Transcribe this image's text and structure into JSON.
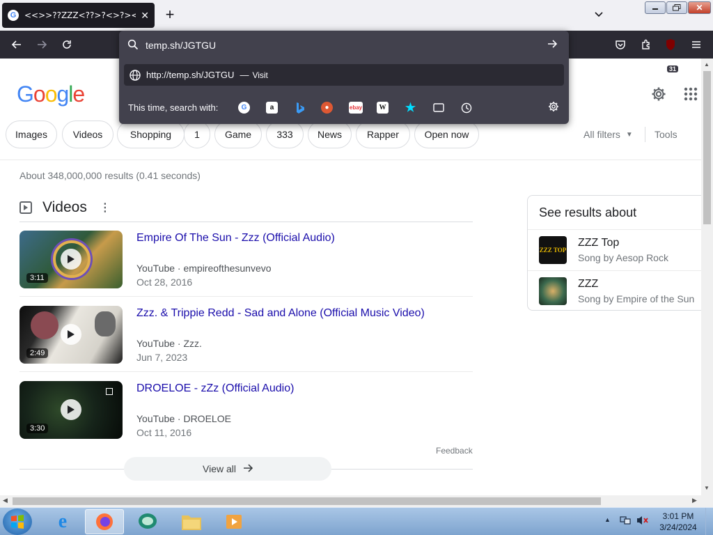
{
  "browser": {
    "tab_title": "<<>>??ZZZ<??>?<>?><?><",
    "tab_favicon": "G",
    "colors": {
      "tab_bg": "#1c1b22",
      "toolbar_bg": "#2b2a33",
      "urlbar_bg": "#42414d"
    }
  },
  "toolbar": {
    "ublock_badge": "31"
  },
  "urlbar": {
    "value": "temp.sh/JGTGU",
    "suggestion_url": "http://temp.sh/JGTGU",
    "suggestion_sep": "—",
    "suggestion_action": "Visit",
    "search_with_label": "This time, search with:",
    "engines": [
      "google",
      "amazon",
      "bing",
      "duckduckgo",
      "ebay",
      "wikipedia",
      "bookmarks",
      "tabs",
      "history"
    ]
  },
  "google": {
    "logo_letters": [
      "G",
      "o",
      "o",
      "g",
      "l",
      "e"
    ],
    "chips": [
      "Images",
      "Videos",
      "Shopping",
      "1",
      "Game",
      "333",
      "News",
      "Rapper",
      "Open now"
    ],
    "all_filters": "All filters",
    "tools": "Tools",
    "stats": "About 348,000,000 results (0.41 seconds)",
    "videos_heading": "Videos",
    "videos": [
      {
        "title": "Empire Of The Sun - Zzz (Official Audio)",
        "source": "YouTube · empireofthesunvevo",
        "date": "Oct 28, 2016",
        "duration": "3:11"
      },
      {
        "title": "Zzz. & Trippie Redd - Sad and Alone (Official Music Video)",
        "source": "YouTube · Zzz.",
        "date": "Jun 7, 2023",
        "duration": "2:49"
      },
      {
        "title": "DROELOE - zZz (Official Audio)",
        "source": "YouTube · DROELOE",
        "date": "Oct 11, 2016",
        "duration": "3:30"
      }
    ],
    "feedback": "Feedback",
    "view_all": "View all",
    "knowledge": {
      "title": "See results about",
      "items": [
        {
          "name": "ZZZ Top",
          "sub": "Song by Aesop Rock",
          "thumb_text": "ZZZ TOP"
        },
        {
          "name": "ZZZ",
          "sub": "Song by Empire of the Sun"
        }
      ]
    },
    "colors": {
      "link": "#1a0dab",
      "muted": "#70757a"
    }
  },
  "taskbar": {
    "time": "3:01 PM",
    "date": "3/24/2024"
  }
}
